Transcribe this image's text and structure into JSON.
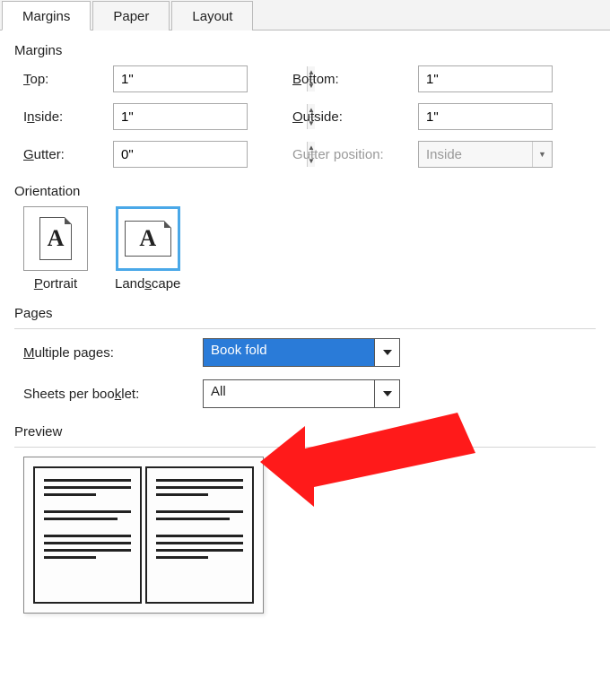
{
  "tabs": {
    "margins": "Margins",
    "paper": "Paper",
    "layout": "Layout"
  },
  "sections": {
    "margins": "Margins",
    "orientation": "Orientation",
    "pages": "Pages",
    "preview": "Preview"
  },
  "margins": {
    "top_label": "Top:",
    "top_value": "1\"",
    "bottom_label": "Bottom:",
    "bottom_value": "1\"",
    "inside_label": "Inside:",
    "inside_value": "1\"",
    "outside_label": "Outside:",
    "outside_value": "1\"",
    "gutter_label": "Gutter:",
    "gutter_value": "0\"",
    "gutter_pos_label": "Gutter position:",
    "gutter_pos_value": "Inside"
  },
  "orientation": {
    "portrait": "Portrait",
    "landscape": "Landscape",
    "selected": "landscape"
  },
  "pages": {
    "multiple_label": "Multiple pages:",
    "multiple_value": "Book fold",
    "sheets_label": "Sheets per booklet:",
    "sheets_value": "All"
  }
}
